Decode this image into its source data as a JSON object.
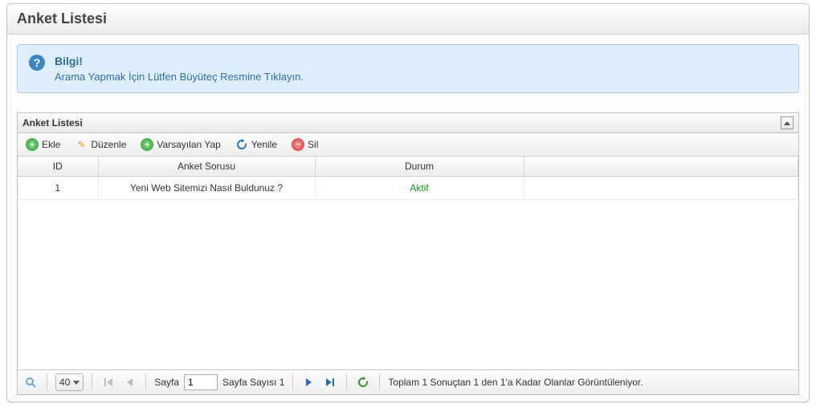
{
  "page": {
    "title": "Anket Listesi"
  },
  "info": {
    "title": "Bilgi!",
    "message": "Arama Yapmak İçin Lütfen Büyüteç Resmine Tıklayın."
  },
  "grid": {
    "title": "Anket Listesi",
    "toolbar": {
      "add": "Ekle",
      "edit": "Düzenle",
      "set_default": "Varsayılan Yap",
      "refresh": "Yenile",
      "delete": "Sil"
    },
    "columns": {
      "id": "ID",
      "question": "Anket Sorusu",
      "status": "Durum"
    },
    "rows": [
      {
        "id": "1",
        "question": "Yeni Web Sitemizi Nasıl Buldunuz ?",
        "status": "Aktif"
      }
    ]
  },
  "pager": {
    "page_size": "40",
    "page_label": "Sayfa",
    "page_value": "1",
    "page_count_label": "Sayfa Sayısı 1",
    "summary": "Toplam 1 Sonuçtan 1 den 1'a Kadar Olanlar Görüntüleniyor."
  }
}
